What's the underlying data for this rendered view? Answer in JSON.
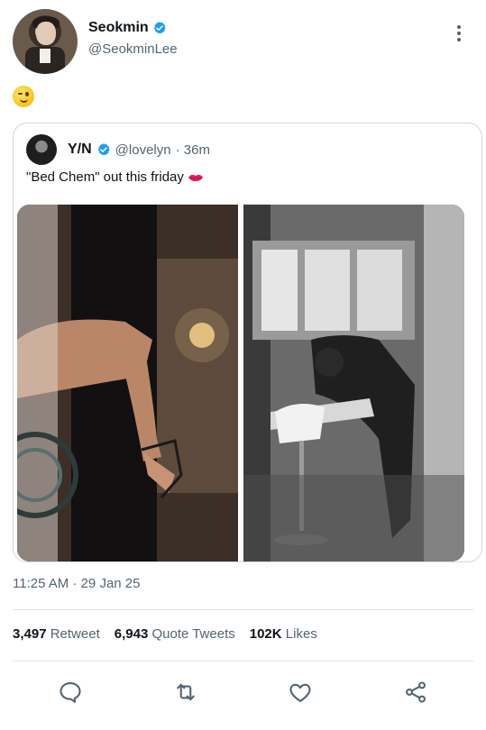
{
  "author": {
    "display_name": "Seokmin",
    "handle": "@SeokminLee",
    "verified": true
  },
  "tweet_text_emoji": "winking-face",
  "quoted_tweet": {
    "display_name": "Y/N",
    "handle": "@lovelyn",
    "time_ago": "· 36m",
    "text": "\"Bed Chem\" out this friday",
    "text_emoji": "kiss-mark",
    "verified": true,
    "media": [
      {
        "description_icon": "photo-left"
      },
      {
        "description_icon": "photo-right"
      }
    ]
  },
  "timestamp": "11:25 AM · 29 Jan 25",
  "stats": {
    "retweets_count": "3,497",
    "retweets_label": "Retweet",
    "quote_count": "6,943",
    "quote_label": "Quote Tweets",
    "likes_count": "102K",
    "likes_label": "Likes"
  },
  "actions": [
    "reply-icon",
    "retweet-icon",
    "like-icon",
    "share-icon"
  ],
  "colors": {
    "verified": "#1d9bf0",
    "secondary_text": "#536471",
    "primary_text": "#0f1419",
    "divider": "#dfe3e6"
  }
}
